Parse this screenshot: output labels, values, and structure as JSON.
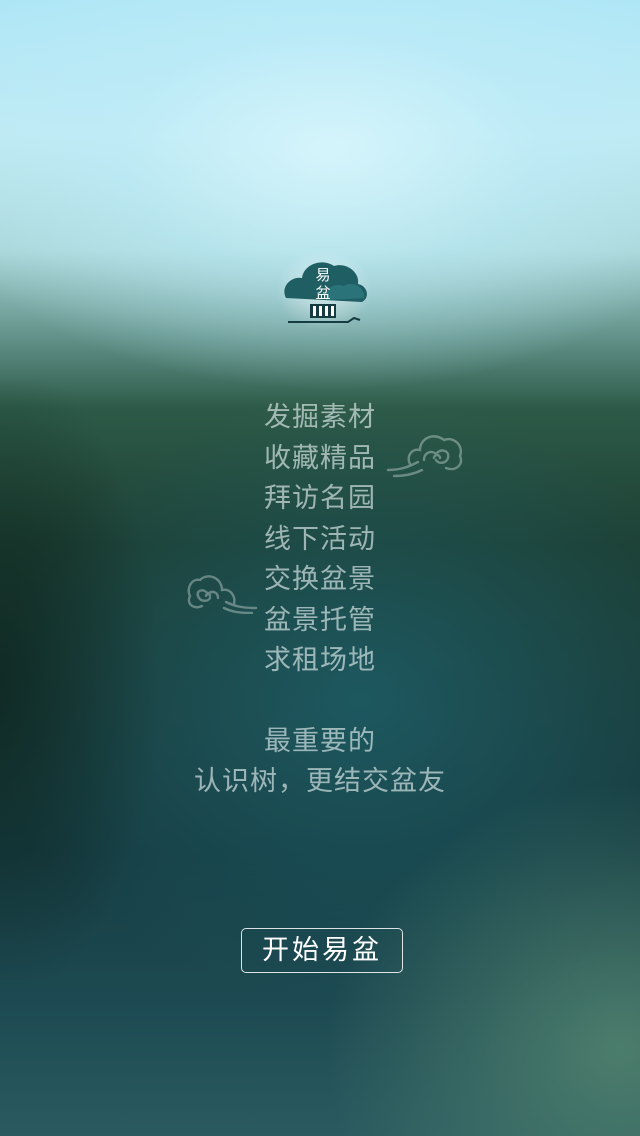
{
  "app": {
    "logo": {
      "text_top": "易",
      "text_bottom": "盆",
      "icon": "bonsai-tree-logo"
    }
  },
  "features": [
    "发掘素材",
    "收藏精品",
    "拜访名园",
    "线下活动",
    "交换盆景",
    "盆景托管",
    "求租场地"
  ],
  "tagline": {
    "line1": "最重要的",
    "line2": "认识树，更结交盆友"
  },
  "start_button": {
    "label": "开始易盆"
  },
  "decorations": [
    "cloud-icon",
    "cloud-icon"
  ],
  "colors": {
    "logo_teal": "#1f5f64",
    "text": "#e8f2f2",
    "button_border": "#ffffff"
  }
}
